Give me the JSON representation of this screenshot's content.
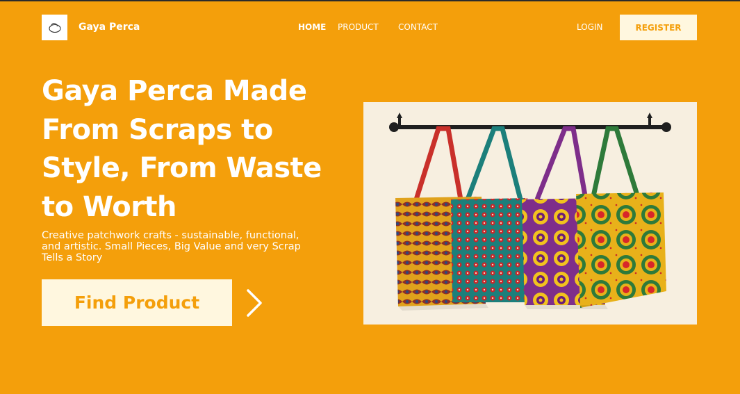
{
  "navbar": {
    "logo_icon": "spiral-pot-logo-icon",
    "brand": "Gaya Perca",
    "links": [
      {
        "label": "HOME",
        "active": true
      },
      {
        "label": "PRODUCT",
        "active": false
      },
      {
        "label": "CONTACT",
        "active": false
      }
    ],
    "login_label": "LOGIN",
    "register_label": "REGISTER"
  },
  "hero": {
    "title": "Gaya Perca Made From Scraps to Style, From Waste to Worth",
    "subtitle": "Creative patchwork crafts - sustainable, functional, and artistic. Small Pieces, Big Value and very Scrap Tells a Story",
    "cta_label": "Find Product",
    "cta_icon": "chevron-right-icon",
    "image": "four-patchwork-tote-bags-on-rail"
  },
  "colors": {
    "background": "#F49F0B",
    "button_bg": "#FFF7DF",
    "text_light": "#FFFFFF",
    "accent": "#F49F0B"
  }
}
